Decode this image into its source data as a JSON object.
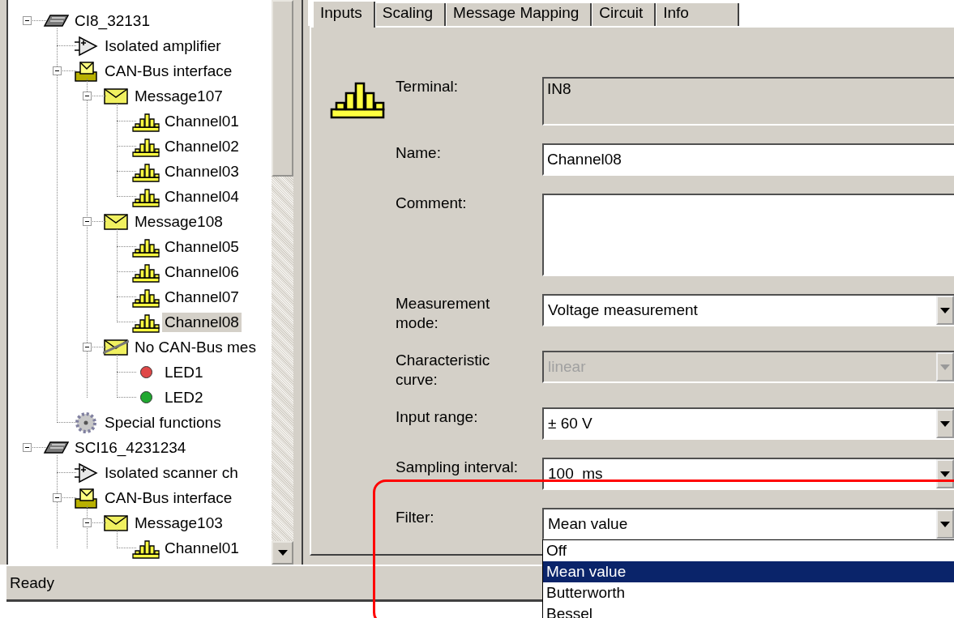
{
  "tree": {
    "items": [
      {
        "kind": "device",
        "label": "CI8_32131",
        "expanded": true,
        "selected": false,
        "children": [
          {
            "kind": "amplifier",
            "label": "Isolated amplifier",
            "selected": false
          },
          {
            "kind": "canbus",
            "label": "CAN-Bus interface",
            "expanded": true,
            "selected": false,
            "children": [
              {
                "kind": "message",
                "label": "Message107",
                "expanded": true,
                "selected": false,
                "children": [
                  {
                    "kind": "channel",
                    "label": "Channel01",
                    "selected": false
                  },
                  {
                    "kind": "channel",
                    "label": "Channel02",
                    "selected": false
                  },
                  {
                    "kind": "channel",
                    "label": "Channel03",
                    "selected": false
                  },
                  {
                    "kind": "channel",
                    "label": "Channel04",
                    "selected": false
                  }
                ]
              },
              {
                "kind": "message",
                "label": "Message108",
                "expanded": true,
                "selected": false,
                "children": [
                  {
                    "kind": "channel",
                    "label": "Channel05",
                    "selected": false
                  },
                  {
                    "kind": "channel",
                    "label": "Channel06",
                    "selected": false
                  },
                  {
                    "kind": "channel",
                    "label": "Channel07",
                    "selected": false
                  },
                  {
                    "kind": "channel",
                    "label": "Channel08",
                    "selected": true
                  }
                ]
              },
              {
                "kind": "nomessage",
                "label": "No CAN-Bus mes",
                "expanded": true,
                "selected": false,
                "children": [
                  {
                    "kind": "led",
                    "label": "LED1",
                    "color": "#e04848",
                    "selected": false
                  },
                  {
                    "kind": "led",
                    "label": "LED2",
                    "color": "#20a830",
                    "selected": false
                  }
                ]
              }
            ]
          },
          {
            "kind": "gear",
            "label": "Special functions",
            "selected": false
          }
        ]
      },
      {
        "kind": "device",
        "label": "SCI16_4231234",
        "expanded": true,
        "selected": false,
        "children": [
          {
            "kind": "amplifier",
            "label": "Isolated scanner ch",
            "selected": false
          },
          {
            "kind": "canbus",
            "label": "CAN-Bus interface",
            "expanded": true,
            "selected": false,
            "children": [
              {
                "kind": "message",
                "label": "Message103",
                "expanded": true,
                "selected": false,
                "children": [
                  {
                    "kind": "channel",
                    "label": "Channel01",
                    "selected": false
                  }
                ]
              }
            ]
          }
        ]
      }
    ]
  },
  "properties": {
    "tabs": [
      {
        "label": "Inputs",
        "selected": true
      },
      {
        "label": "Scaling",
        "selected": false
      },
      {
        "label": "Message Mapping",
        "selected": false
      },
      {
        "label": "Circuit",
        "selected": false
      },
      {
        "label": "Info",
        "selected": false
      }
    ],
    "fields": [
      {
        "kind": "readonly",
        "label": "Terminal:",
        "value": "IN8"
      },
      {
        "kind": "text",
        "label": "Name:",
        "value": "Channel08"
      },
      {
        "kind": "textarea",
        "label": "Comment:"
      },
      {
        "kind": "select",
        "label": "Measurement mode:",
        "value": "Voltage measurement",
        "disabled": false
      },
      {
        "kind": "select",
        "label": "Characteristic curve:",
        "value": "linear",
        "disabled": true
      },
      {
        "kind": "select",
        "label": "Input range:",
        "value": "± 60 V",
        "disabled": false
      },
      {
        "kind": "select",
        "label": "Sampling interval:",
        "value": "100  ms",
        "disabled": false
      },
      {
        "kind": "select",
        "label": "Filter:",
        "value": "Mean value",
        "disabled": false,
        "open": true,
        "options": [
          {
            "label": "Off",
            "selected": false
          },
          {
            "label": "Mean value",
            "selected": true
          },
          {
            "label": "Butterworth",
            "selected": false
          },
          {
            "label": "Bessel",
            "selected": false
          }
        ]
      }
    ]
  },
  "status_bar": {
    "text": "Ready"
  }
}
